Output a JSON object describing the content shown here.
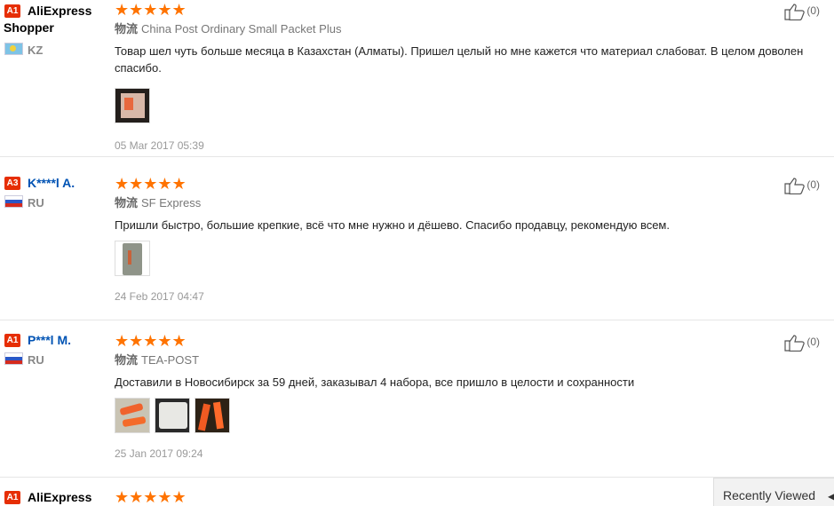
{
  "reviews": [
    {
      "level": "A1",
      "name": "AliExpress",
      "name_line2": "Shopper",
      "country": "KZ",
      "stars": "★★★★★",
      "logistics_label": "物流",
      "logistics": "China Post Ordinary Small Packet Plus",
      "text": "Товар шел чуть больше месяца в Казахстан (Алматы). Пришел целый но мне кажется что материал слабоват. В целом доволен спасибо.",
      "date": "05 Mar 2017 05:39",
      "likes": "(0)"
    },
    {
      "level": "A3",
      "name": "K****l A.",
      "country": "RU",
      "stars": "★★★★★",
      "logistics_label": "物流",
      "logistics": "SF Express",
      "text": "Пришли быстро, большие крепкие, всё что мне нужно и дёшево. Спасибо продавцу, рекомендую всем.",
      "date": "24 Feb 2017 04:47",
      "likes": "(0)"
    },
    {
      "level": "A1",
      "name": "P***l M.",
      "country": "RU",
      "stars": "★★★★★",
      "logistics_label": "物流",
      "logistics": "TEA-POST",
      "text": "Доставили в Новосибирск за 59 дней, заказывал 4 набора, все пришло в целости и сохранности",
      "date": "25 Jan 2017 09:24",
      "likes": "(0)"
    },
    {
      "level": "A1",
      "name": "AliExpress",
      "stars": "★★★★★"
    }
  ],
  "recently_viewed": {
    "label": "Recently Viewed",
    "icon": "chevron-icon"
  },
  "colors": {
    "star": "#ff7300",
    "badge": "#e62e04",
    "username_link": "#0053b4"
  }
}
